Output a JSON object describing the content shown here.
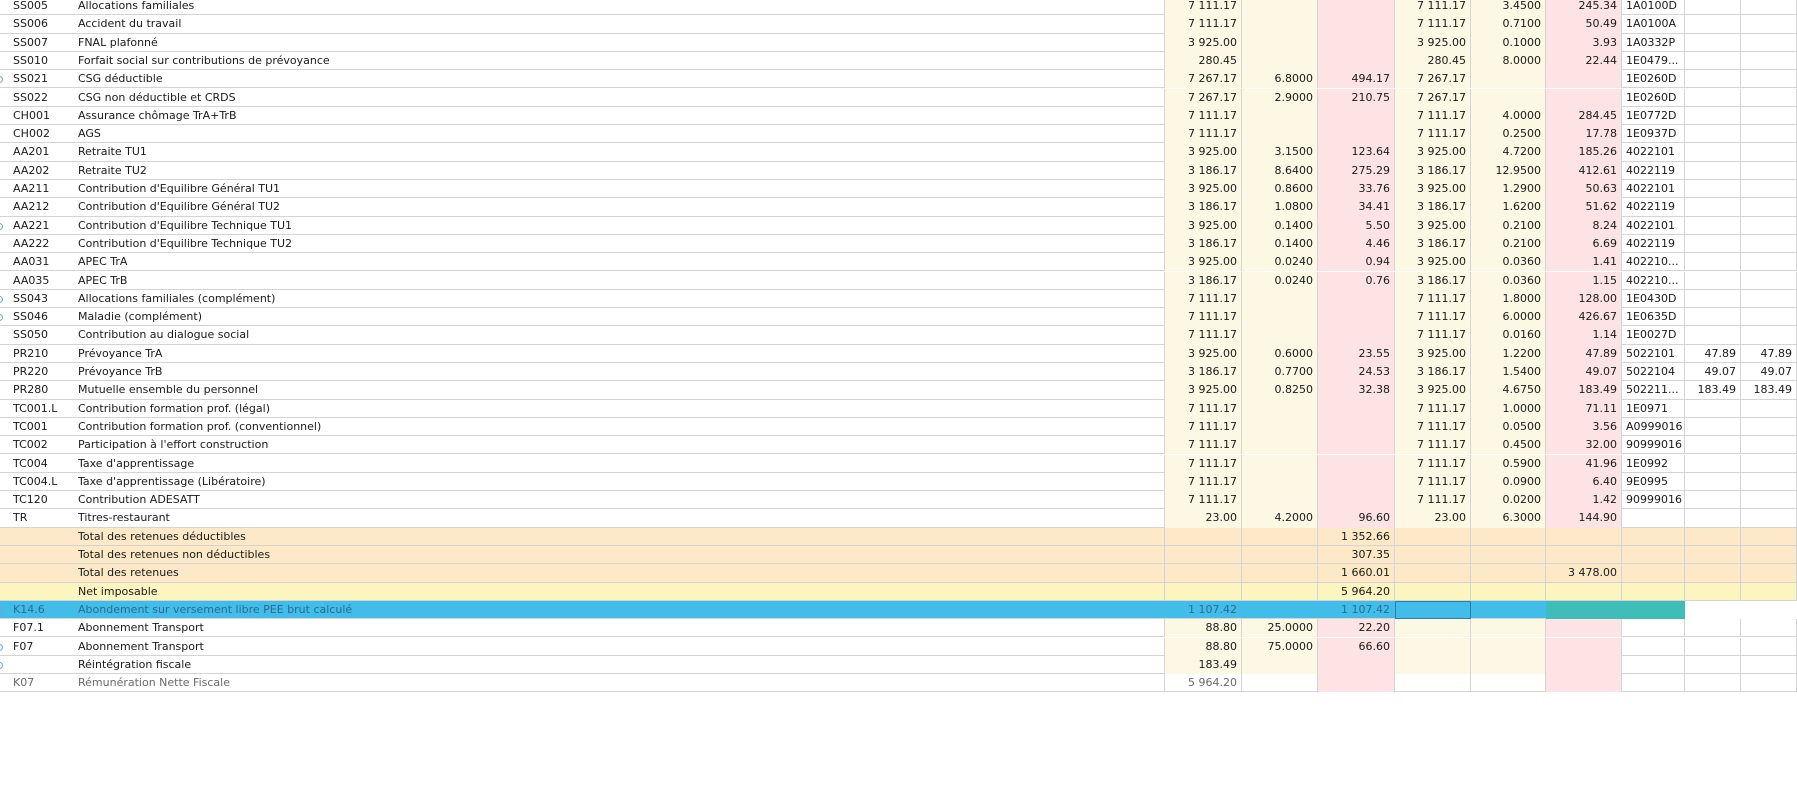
{
  "rows": [
    {
      "code": "SS005",
      "label": "Allocations familiales",
      "base": "7 111.17",
      "tx_sal": "",
      "mt_sal": "",
      "base_pat": "7 111.17",
      "tx_pat": "3.4500",
      "mt_pat": "245.34",
      "compte": "1A0100D",
      "x1": "",
      "x2": "",
      "bg": "std",
      "marker": false
    },
    {
      "code": "SS006",
      "label": "Accident du travail",
      "base": "7 111.17",
      "tx_sal": "",
      "mt_sal": "",
      "base_pat": "7 111.17",
      "tx_pat": "0.7100",
      "mt_pat": "50.49",
      "compte": "1A0100A",
      "x1": "",
      "x2": "",
      "bg": "std",
      "marker": false
    },
    {
      "code": "SS007",
      "label": "FNAL plafonné",
      "base": "3 925.00",
      "tx_sal": "",
      "mt_sal": "",
      "base_pat": "3 925.00",
      "tx_pat": "0.1000",
      "mt_pat": "3.93",
      "compte": "1A0332P",
      "x1": "",
      "x2": "",
      "bg": "std",
      "marker": false
    },
    {
      "code": "SS010",
      "label": "Forfait social sur contributions de prévoyance",
      "base": "280.45",
      "tx_sal": "",
      "mt_sal": "",
      "base_pat": "280.45",
      "tx_pat": "8.0000",
      "mt_pat": "22.44",
      "compte": "1E0479...",
      "x1": "",
      "x2": "",
      "bg": "std",
      "marker": false
    },
    {
      "code": "SS021",
      "label": "CSG déductible",
      "base": "7 267.17",
      "tx_sal": "6.8000",
      "mt_sal": "494.17",
      "base_pat": "7 267.17",
      "tx_pat": "",
      "mt_pat": "",
      "compte": "1E0260D",
      "x1": "",
      "x2": "",
      "bg": "std",
      "marker": true
    },
    {
      "code": "SS022",
      "label": "CSG non déductible et CRDS",
      "base": "7 267.17",
      "tx_sal": "2.9000",
      "mt_sal": "210.75",
      "base_pat": "7 267.17",
      "tx_pat": "",
      "mt_pat": "",
      "compte": "1E0260D",
      "x1": "",
      "x2": "",
      "bg": "std",
      "marker": false
    },
    {
      "code": "CH001",
      "label": "Assurance chômage TrA+TrB",
      "base": "7 111.17",
      "tx_sal": "",
      "mt_sal": "",
      "base_pat": "7 111.17",
      "tx_pat": "4.0000",
      "mt_pat": "284.45",
      "compte": "1E0772D",
      "x1": "",
      "x2": "",
      "bg": "std",
      "marker": false
    },
    {
      "code": "CH002",
      "label": "AGS",
      "base": "7 111.17",
      "tx_sal": "",
      "mt_sal": "",
      "base_pat": "7 111.17",
      "tx_pat": "0.2500",
      "mt_pat": "17.78",
      "compte": "1E0937D",
      "x1": "",
      "x2": "",
      "bg": "std",
      "marker": false
    },
    {
      "code": "AA201",
      "label": "Retraite TU1",
      "base": "3 925.00",
      "tx_sal": "3.1500",
      "mt_sal": "123.64",
      "base_pat": "3 925.00",
      "tx_pat": "4.7200",
      "mt_pat": "185.26",
      "compte": "4022101",
      "x1": "",
      "x2": "",
      "bg": "std",
      "marker": false
    },
    {
      "code": "AA202",
      "label": "Retraite TU2",
      "base": "3 186.17",
      "tx_sal": "8.6400",
      "mt_sal": "275.29",
      "base_pat": "3 186.17",
      "tx_pat": "12.9500",
      "mt_pat": "412.61",
      "compte": "4022119",
      "x1": "",
      "x2": "",
      "bg": "std",
      "marker": false
    },
    {
      "code": "AA211",
      "label": "Contribution d'Equilibre Général TU1",
      "base": "3 925.00",
      "tx_sal": "0.8600",
      "mt_sal": "33.76",
      "base_pat": "3 925.00",
      "tx_pat": "1.2900",
      "mt_pat": "50.63",
      "compte": "4022101",
      "x1": "",
      "x2": "",
      "bg": "std",
      "marker": false
    },
    {
      "code": "AA212",
      "label": "Contribution d'Equilibre Général TU2",
      "base": "3 186.17",
      "tx_sal": "1.0800",
      "mt_sal": "34.41",
      "base_pat": "3 186.17",
      "tx_pat": "1.6200",
      "mt_pat": "51.62",
      "compte": "4022119",
      "x1": "",
      "x2": "",
      "bg": "std",
      "marker": false
    },
    {
      "code": "AA221",
      "label": "Contribution d'Equilibre Technique TU1",
      "base": "3 925.00",
      "tx_sal": "0.1400",
      "mt_sal": "5.50",
      "base_pat": "3 925.00",
      "tx_pat": "0.2100",
      "mt_pat": "8.24",
      "compte": "4022101",
      "x1": "",
      "x2": "",
      "bg": "std",
      "marker": true
    },
    {
      "code": "AA222",
      "label": "Contribution d'Equilibre Technique TU2",
      "base": "3 186.17",
      "tx_sal": "0.1400",
      "mt_sal": "4.46",
      "base_pat": "3 186.17",
      "tx_pat": "0.2100",
      "mt_pat": "6.69",
      "compte": "4022119",
      "x1": "",
      "x2": "",
      "bg": "std",
      "marker": false
    },
    {
      "code": "AA031",
      "label": "APEC TrA",
      "base": "3 925.00",
      "tx_sal": "0.0240",
      "mt_sal": "0.94",
      "base_pat": "3 925.00",
      "tx_pat": "0.0360",
      "mt_pat": "1.41",
      "compte": "402210...",
      "x1": "",
      "x2": "",
      "bg": "std",
      "marker": false
    },
    {
      "code": "AA035",
      "label": "APEC TrB",
      "base": "3 186.17",
      "tx_sal": "0.0240",
      "mt_sal": "0.76",
      "base_pat": "3 186.17",
      "tx_pat": "0.0360",
      "mt_pat": "1.15",
      "compte": "402210...",
      "x1": "",
      "x2": "",
      "bg": "std",
      "marker": false
    },
    {
      "code": "SS043",
      "label": "Allocations familiales (complément)",
      "base": "7 111.17",
      "tx_sal": "",
      "mt_sal": "",
      "base_pat": "7 111.17",
      "tx_pat": "1.8000",
      "mt_pat": "128.00",
      "compte": "1E0430D",
      "x1": "",
      "x2": "",
      "bg": "std",
      "marker": true
    },
    {
      "code": "SS046",
      "label": "Maladie (complément)",
      "base": "7 111.17",
      "tx_sal": "",
      "mt_sal": "",
      "base_pat": "7 111.17",
      "tx_pat": "6.0000",
      "mt_pat": "426.67",
      "compte": "1E0635D",
      "x1": "",
      "x2": "",
      "bg": "std",
      "marker": true
    },
    {
      "code": "SS050",
      "label": "Contribution au dialogue social",
      "base": "7 111.17",
      "tx_sal": "",
      "mt_sal": "",
      "base_pat": "7 111.17",
      "tx_pat": "0.0160",
      "mt_pat": "1.14",
      "compte": "1E0027D",
      "x1": "",
      "x2": "",
      "bg": "std",
      "marker": false
    },
    {
      "code": "PR210",
      "label": "Prévoyance TrA",
      "base": "3 925.00",
      "tx_sal": "0.6000",
      "mt_sal": "23.55",
      "base_pat": "3 925.00",
      "tx_pat": "1.2200",
      "mt_pat": "47.89",
      "compte": "5022101",
      "x1": "47.89",
      "x2": "47.89",
      "bg": "std",
      "marker": false
    },
    {
      "code": "PR220",
      "label": "Prévoyance TrB",
      "base": "3 186.17",
      "tx_sal": "0.7700",
      "mt_sal": "24.53",
      "base_pat": "3 186.17",
      "tx_pat": "1.5400",
      "mt_pat": "49.07",
      "compte": "5022104",
      "x1": "49.07",
      "x2": "49.07",
      "bg": "std",
      "marker": false
    },
    {
      "code": "PR280",
      "label": "Mutuelle ensemble du personnel",
      "base": "3 925.00",
      "tx_sal": "0.8250",
      "mt_sal": "32.38",
      "base_pat": "3 925.00",
      "tx_pat": "4.6750",
      "mt_pat": "183.49",
      "compte": "502211...",
      "x1": "183.49",
      "x2": "183.49",
      "bg": "std",
      "marker": false
    },
    {
      "code": "TC001.L",
      "label": "Contribution formation prof. (légal)",
      "base": "7 111.17",
      "tx_sal": "",
      "mt_sal": "",
      "base_pat": "7 111.17",
      "tx_pat": "1.0000",
      "mt_pat": "71.11",
      "compte": "1E0971",
      "x1": "",
      "x2": "",
      "bg": "std",
      "marker": false
    },
    {
      "code": "TC001",
      "label": "Contribution formation prof. (conventionnel)",
      "base": "7 111.17",
      "tx_sal": "",
      "mt_sal": "",
      "base_pat": "7 111.17",
      "tx_pat": "0.0500",
      "mt_pat": "3.56",
      "compte": "A0999016",
      "x1": "",
      "x2": "",
      "bg": "std",
      "marker": false
    },
    {
      "code": "TC002",
      "label": "Participation à l'effort construction",
      "base": "7 111.17",
      "tx_sal": "",
      "mt_sal": "",
      "base_pat": "7 111.17",
      "tx_pat": "0.4500",
      "mt_pat": "32.00",
      "compte": "90999016",
      "x1": "",
      "x2": "",
      "bg": "std",
      "marker": false
    },
    {
      "code": "TC004",
      "label": "Taxe d'apprentissage",
      "base": "7 111.17",
      "tx_sal": "",
      "mt_sal": "",
      "base_pat": "7 111.17",
      "tx_pat": "0.5900",
      "mt_pat": "41.96",
      "compte": "1E0992",
      "x1": "",
      "x2": "",
      "bg": "std",
      "marker": false
    },
    {
      "code": "TC004.L",
      "label": "Taxe d'apprentissage (Libératoire)",
      "base": "7 111.17",
      "tx_sal": "",
      "mt_sal": "",
      "base_pat": "7 111.17",
      "tx_pat": "0.0900",
      "mt_pat": "6.40",
      "compte": "9E0995",
      "x1": "",
      "x2": "",
      "bg": "std",
      "marker": false
    },
    {
      "code": "TC120",
      "label": "Contribution ADESATT",
      "base": "7 111.17",
      "tx_sal": "",
      "mt_sal": "",
      "base_pat": "7 111.17",
      "tx_pat": "0.0200",
      "mt_pat": "1.42",
      "compte": "90999016",
      "x1": "",
      "x2": "",
      "bg": "std",
      "marker": false
    },
    {
      "code": "TR",
      "label": "Titres-restaurant",
      "base": "23.00",
      "tx_sal": "4.2000",
      "mt_sal": "96.60",
      "base_pat": "23.00",
      "tx_pat": "6.3000",
      "mt_pat": "144.90",
      "compte": "",
      "x1": "",
      "x2": "",
      "bg": "std",
      "marker": false
    },
    {
      "code": "",
      "label": "Total des retenues déductibles",
      "base": "",
      "tx_sal": "",
      "mt_sal": "1 352.66",
      "base_pat": "",
      "tx_pat": "",
      "mt_pat": "",
      "compte": "",
      "x1": "",
      "x2": "",
      "bg": "tot",
      "marker": false
    },
    {
      "code": "",
      "label": "Total des retenues non déductibles",
      "base": "",
      "tx_sal": "",
      "mt_sal": "307.35",
      "base_pat": "",
      "tx_pat": "",
      "mt_pat": "",
      "compte": "",
      "x1": "",
      "x2": "",
      "bg": "tot",
      "marker": false
    },
    {
      "code": "",
      "label": "Total des retenues",
      "base": "",
      "tx_sal": "",
      "mt_sal": "1 660.01",
      "base_pat": "",
      "tx_pat": "",
      "mt_pat": "3 478.00",
      "compte": "",
      "x1": "",
      "x2": "",
      "bg": "tot",
      "marker": false
    },
    {
      "code": "",
      "label": "Net imposable",
      "base": "",
      "tx_sal": "",
      "mt_sal": "5 964.20",
      "base_pat": "",
      "tx_pat": "",
      "mt_pat": "",
      "compte": "",
      "x1": "",
      "x2": "",
      "bg": "net",
      "marker": false
    },
    {
      "code": "K14.6",
      "label": "Abondement sur versement libre PEE brut calculé",
      "base": "1 107.42",
      "tx_sal": "",
      "mt_sal": "1 107.42",
      "base_pat": "",
      "tx_pat": "",
      "mt_pat": "",
      "compte": "",
      "x1": "",
      "x2": "",
      "bg": "sel",
      "marker": true
    },
    {
      "code": "F07.1",
      "label": "Abonnement Transport",
      "base": "88.80",
      "tx_sal": "25.0000",
      "mt_sal": "22.20",
      "base_pat": "",
      "tx_pat": "",
      "mt_pat": "",
      "compte": "",
      "x1": "",
      "x2": "",
      "bg": "std",
      "marker": false
    },
    {
      "code": "F07",
      "label": "Abonnement Transport",
      "base": "88.80",
      "tx_sal": "75.0000",
      "mt_sal": "66.60",
      "base_pat": "",
      "tx_pat": "",
      "mt_pat": "",
      "compte": "",
      "x1": "",
      "x2": "",
      "bg": "std",
      "marker": true
    },
    {
      "code": "",
      "label": "Réintégration fiscale",
      "base": "183.49",
      "tx_sal": "",
      "mt_sal": "",
      "base_pat": "",
      "tx_pat": "",
      "mt_pat": "",
      "compte": "",
      "x1": "",
      "x2": "",
      "bg": "std",
      "marker": true
    },
    {
      "code": "K07",
      "label": "Rémunération Nette Fiscale",
      "base": "5 964.20",
      "tx_sal": "",
      "mt_sal": "",
      "base_pat": "",
      "tx_pat": "",
      "mt_pat": "",
      "compte": "",
      "x1": "",
      "x2": "",
      "bg": "grey",
      "marker": false
    }
  ]
}
